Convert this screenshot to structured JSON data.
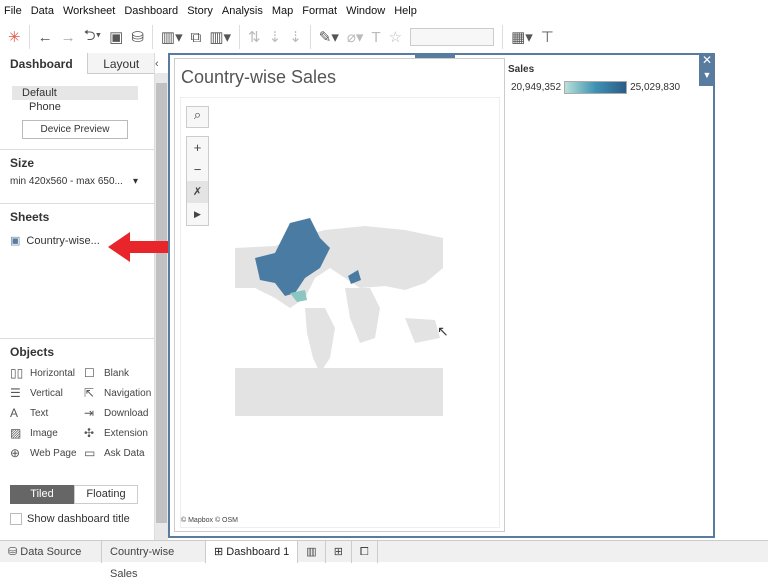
{
  "menu": [
    "File",
    "Data",
    "Worksheet",
    "Dashboard",
    "Story",
    "Analysis",
    "Map",
    "Format",
    "Window",
    "Help"
  ],
  "left": {
    "tab_dashboard": "Dashboard",
    "tab_layout": "Layout",
    "device_default": "Default",
    "device_phone": "Phone",
    "device_preview": "Device Preview",
    "size_heading": "Size",
    "size_value": "min 420x560 - max 650...",
    "sheets_heading": "Sheets",
    "sheet_item": "Country-wise...",
    "objects_heading": "Objects",
    "objects": [
      "Horizontal",
      "Blank",
      "Vertical",
      "Navigation",
      "Text",
      "Download",
      "Image",
      "Extension",
      "Web Page",
      "Ask Data"
    ],
    "tiled": "Tiled",
    "floating": "Floating",
    "show_title": "Show dashboard title"
  },
  "sheet": {
    "title": "Country-wise Sales",
    "attribution": "© Mapbox © OSM"
  },
  "legend": {
    "title": "Sales",
    "min": "20,949,352",
    "max": "25,029,830",
    "color_low": "#b9e0d8",
    "color_high": "#2c5b87"
  },
  "bottom_tabs": {
    "data_source": "Data Source",
    "sheet": "Country-wise Sales",
    "dashboard": "Dashboard 1"
  },
  "colors": {
    "accent": "#587ca0",
    "arrow": "#e8252a"
  }
}
